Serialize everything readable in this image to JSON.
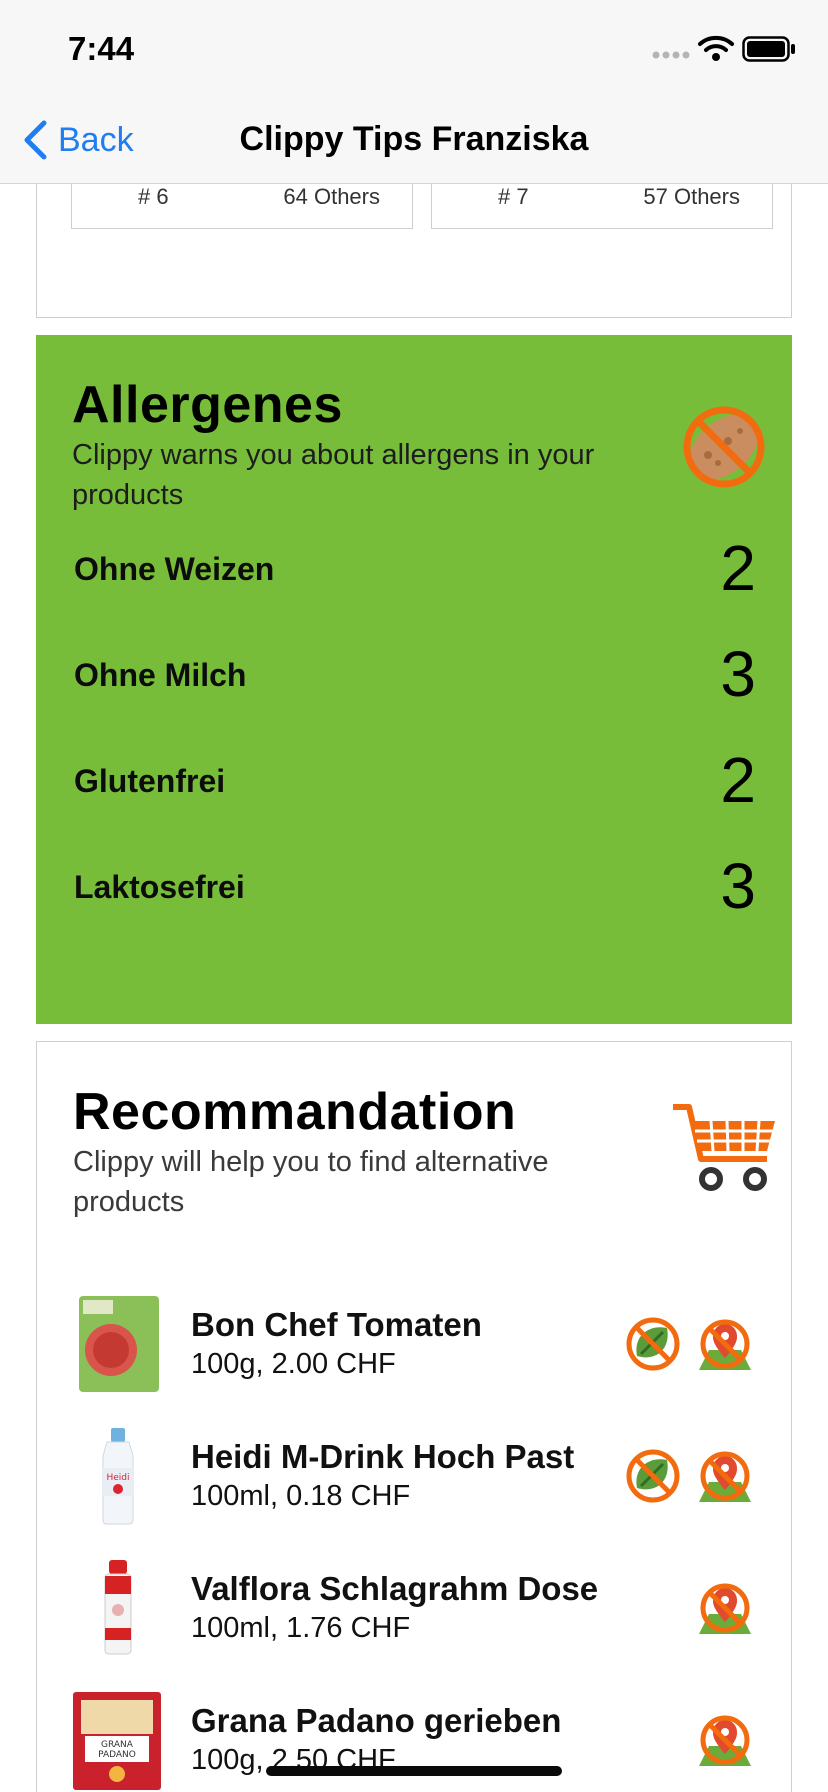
{
  "status_bar": {
    "time": "7:44"
  },
  "nav": {
    "back_label": "Back",
    "title": "Clippy Tips Franziska"
  },
  "ranking": [
    {
      "rank": "# 6",
      "others": "64 Others"
    },
    {
      "rank": "# 7",
      "others": "57 Others"
    }
  ],
  "allergenes": {
    "title": "Allergenes",
    "subtitle": "Clippy warns you about allergens in your products",
    "items": [
      {
        "name": "Ohne Weizen",
        "count": "2"
      },
      {
        "name": "Ohne Milch",
        "count": "3"
      },
      {
        "name": "Glutenfrei",
        "count": "2"
      },
      {
        "name": "Laktosefrei",
        "count": "3"
      }
    ]
  },
  "recommandation": {
    "title": "Recommandation",
    "subtitle": "Clippy will help you to find alternative products",
    "products": [
      {
        "name": "Bon Chef Tomaten",
        "detail": "100g, 2.00 CHF",
        "icons": [
          "no-vegan-icon",
          "no-local-icon"
        ]
      },
      {
        "name": "Heidi M-Drink Hoch Past",
        "detail": "100ml, 0.18 CHF",
        "icons": [
          "no-vegan-icon",
          "no-local-icon"
        ]
      },
      {
        "name": "Valflora Schlagrahm Dose",
        "detail": "100ml, 1.76 CHF",
        "icons": [
          "no-local-icon"
        ]
      },
      {
        "name": "Grana Padano gerieben",
        "detail": "100g, 2.50 CHF",
        "icons": [
          "no-local-icon"
        ]
      }
    ]
  },
  "colors": {
    "allergen_bg": "#78bd3a",
    "accent_orange": "#f26b0f",
    "ios_blue": "#1f7ef0"
  }
}
